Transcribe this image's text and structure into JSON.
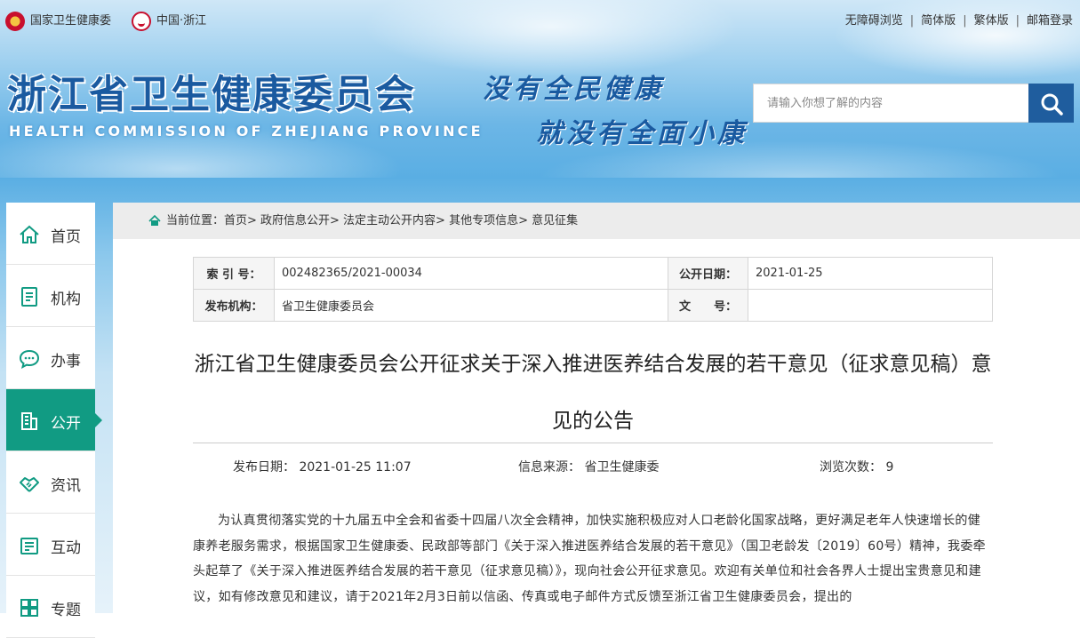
{
  "header": {
    "logo1_text": "国家卫生健康委",
    "logo2_text": "中国·浙江",
    "top_links": [
      "无障碍浏览",
      "简体版",
      "繁体版",
      "邮箱登录"
    ],
    "site_title": "浙江省卫生健康委员会",
    "site_subtitle": "HEALTH COMMISSION OF ZHEJIANG PROVINCE",
    "slogan_line1": "没有全民健康",
    "slogan_line2": "就没有全面小康",
    "search_placeholder": "请输入你想了解的内容"
  },
  "sidebar": {
    "items": [
      {
        "label": "首页",
        "icon": "home-icon"
      },
      {
        "label": "机构",
        "icon": "document-icon"
      },
      {
        "label": "办事",
        "icon": "chat-icon"
      },
      {
        "label": "公开",
        "icon": "building-icon"
      },
      {
        "label": "资讯",
        "icon": "handshake-icon"
      },
      {
        "label": "互动",
        "icon": "form-icon"
      },
      {
        "label": "专题",
        "icon": "grid-icon"
      }
    ],
    "active_index": 3
  },
  "breadcrumb": "当前位置：首页> 政府信息公开> 法定主动公开内容> 其他专项信息> 意见征集",
  "meta": {
    "index_label": "索 引 号：",
    "index_value": "002482365/2021-00034",
    "pubdate_label": "公开日期：",
    "pubdate_value": "2021-01-25",
    "org_label": "发布机构：",
    "org_value": "省卫生健康委员会",
    "docno_label": "文　　号：",
    "docno_value": ""
  },
  "article": {
    "title": "浙江省卫生健康委员会公开征求关于深入推进医养结合发展的若干意见（征求意见稿）意见的公告",
    "publish_time": "发布日期： 2021-01-25 11:07",
    "source": "信息来源： 省卫生健康委",
    "views": "浏览次数： 9",
    "body": "为认真贯彻落实党的十九届五中全会和省委十四届八次全会精神，加快实施积极应对人口老龄化国家战略，更好满足老年人快速增长的健康养老服务需求，根据国家卫生健康委、民政部等部门《关于深入推进医养结合发展的若干意见》（国卫老龄发〔2019〕60号）精神，我委牵头起草了《关于深入推进医养结合发展的若干意见（征求意见稿）》，现向社会公开征求意见。欢迎有关单位和社会各界人士提出宝贵意见和建议，如有修改意见和建议，请于2021年2月3日前以信函、传真或电子邮件方式反馈至浙江省卫生健康委员会，提出的"
  },
  "colors": {
    "accent_green": "#119b83",
    "title_blue": "#1a5aa0",
    "search_blue": "#1f5d9e"
  }
}
